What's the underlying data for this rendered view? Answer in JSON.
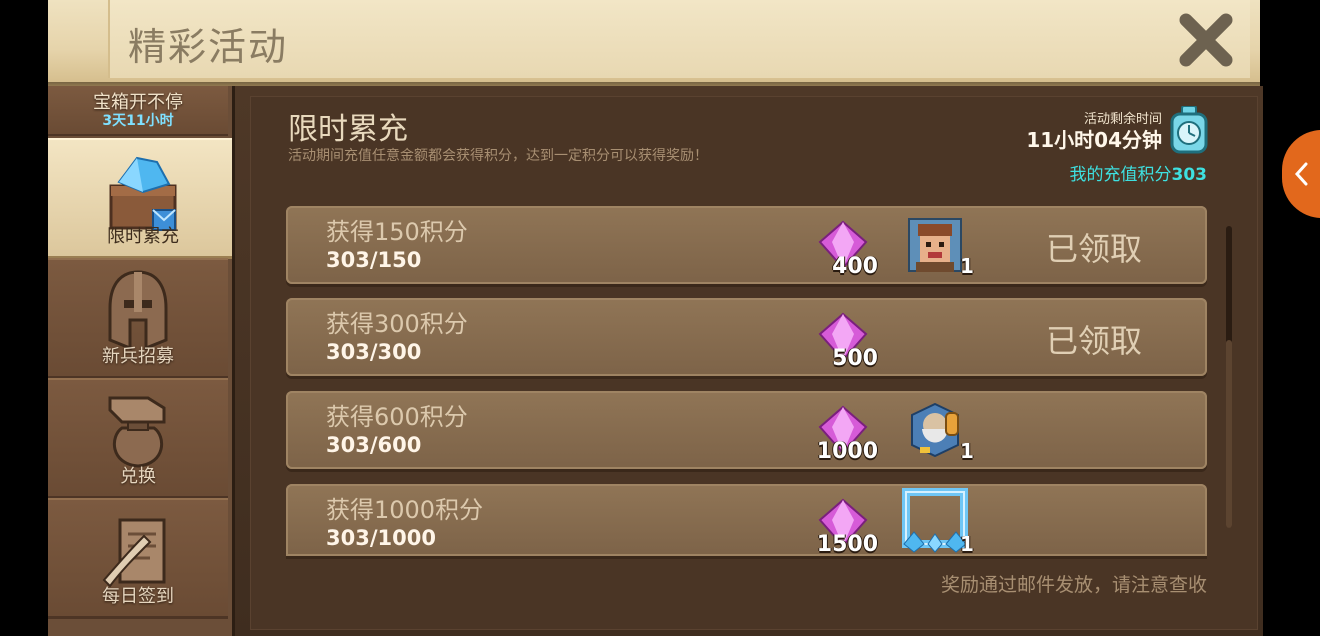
{
  "header": {
    "title": "精彩活动",
    "close_icon": "close-x-icon"
  },
  "sidebar": {
    "top_tab": {
      "label": "宝箱开不停",
      "timer": "3天11小时"
    },
    "tabs": [
      {
        "label": "限时累充",
        "icon": "gem-chest-icon",
        "active": true
      },
      {
        "label": "新兵招募",
        "icon": "helmet-icon",
        "active": false
      },
      {
        "label": "兑换",
        "icon": "hand-bag-icon",
        "active": false
      },
      {
        "label": "每日签到",
        "icon": "scroll-quill-icon",
        "active": false
      }
    ]
  },
  "activity": {
    "title": "限时累充",
    "description": "活动期间充值任意金额都会获得积分，达到一定积分可以获得奖励！",
    "remaining_label": "活动剩余时间",
    "remaining_time": "11小时04分钟",
    "score_label": "我的充值积分",
    "score_value": "303"
  },
  "tiers": [
    {
      "title": "获得150积分",
      "progress": "303/150",
      "gem_count": "400",
      "item_icon": "hero-portrait-icon",
      "item_count": "1",
      "status": "已领取"
    },
    {
      "title": "获得300积分",
      "progress": "303/300",
      "gem_count": "500",
      "item_icon": "",
      "item_count": "",
      "status": "已领取"
    },
    {
      "title": "获得600积分",
      "progress": "303/600",
      "gem_count": "1000",
      "item_icon": "wizard-portrait-icon",
      "item_count": "1",
      "status": ""
    },
    {
      "title": "获得1000积分",
      "progress": "303/1000",
      "gem_count": "1500",
      "item_icon": "crystal-frame-icon",
      "item_count": "1",
      "status": ""
    }
  ],
  "footer_note": "奖励通过邮件发放，请注意查收",
  "colors": {
    "accent_orange": "#e2681c",
    "score_cyan": "#3ee0e0",
    "gem_pink": "#d65bd8"
  }
}
